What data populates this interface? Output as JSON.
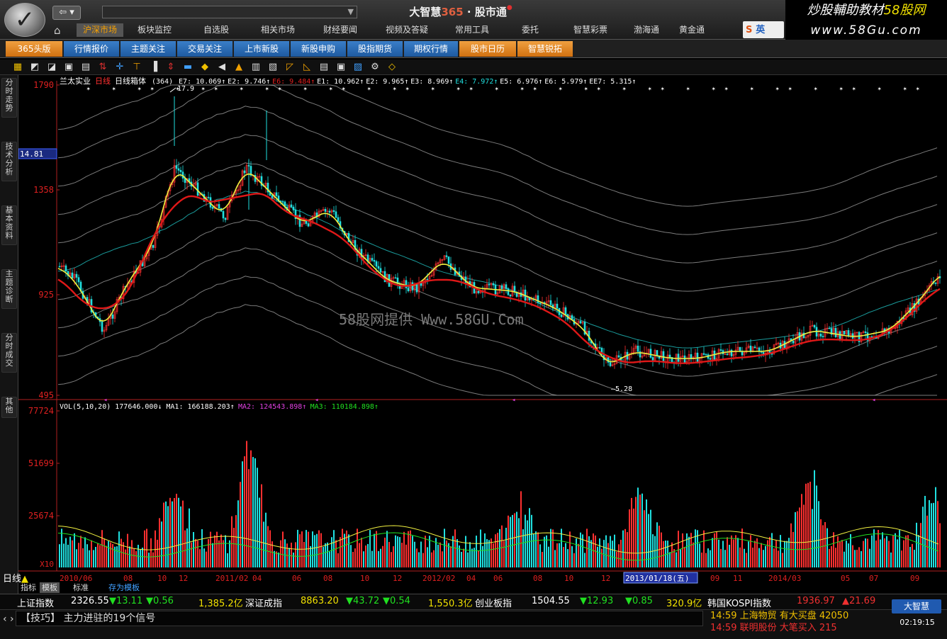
{
  "titlebar": {
    "logo_glyph": "✓",
    "back_label": "⇦ ▾",
    "home_icon": "⌂",
    "address_text": "",
    "address_dropdown": "▼",
    "app_name": "大智慧",
    "app_version": "365",
    "app_sep": "·",
    "app_sub": "股市通",
    "menu": [
      "沪深市场",
      "板块监控",
      "自选股",
      "相关市场",
      "财经要闻",
      "视频及答疑",
      "常用工具",
      "委托",
      "智慧彩票",
      "渤海通",
      "黄金通"
    ],
    "watermark_line1_a": "炒股輔助教材",
    "watermark_line1_b": "58股网",
    "watermark_line2": "www.58Gu.com",
    "ime_s": "S",
    "ime_label": "英"
  },
  "tabs": [
    "365头版",
    "行情报价",
    "主题关注",
    "交易关注",
    "上市新股",
    "新股申购",
    "股指期货",
    "期权行情",
    "股市日历",
    "智慧锐拓"
  ],
  "sidebar": [
    "分时走势",
    "技术分析",
    "基本资料",
    "主题诊断",
    "分时成交",
    "其他"
  ],
  "chart_data": {
    "type": "candlestick",
    "stock_name": "兰太实业",
    "period_label": "日线",
    "indicator_name": "日线箱体",
    "indicator_param": "(364)",
    "indicator_values": [
      {
        "name": "E7",
        "value": "10.069",
        "dir": "↑",
        "color": "#ffffff"
      },
      {
        "name": "E2",
        "value": "9.746",
        "dir": "↑",
        "color": "#ffffff"
      },
      {
        "name": "E6",
        "value": "9.484",
        "dir": "↑",
        "color": "#e02020"
      },
      {
        "name": "E1",
        "value": "10.962",
        "dir": "↑",
        "color": "#ffffff"
      },
      {
        "name": "E2",
        "value": "9.965",
        "dir": "↑",
        "color": "#ffffff"
      },
      {
        "name": "E3",
        "value": "8.969",
        "dir": "↑",
        "color": "#ffffff"
      },
      {
        "name": "E4",
        "value": "7.972",
        "dir": "↑",
        "color": "#20e0e0"
      },
      {
        "name": "E5",
        "value": "6.976",
        "dir": "↑",
        "color": "#ffffff"
      },
      {
        "name": "E6",
        "value": "5.979",
        "dir": "↑",
        "color": "#ffffff"
      },
      {
        "name": "EE7",
        "value": "5.315",
        "dir": "↑",
        "color": "#ffffff"
      }
    ],
    "price_ticks": [
      "1790",
      "1358",
      "925",
      "495"
    ],
    "current_price_label": "14.81",
    "max_marker": "17.9",
    "min_marker": "5.28",
    "vol_indicator": "VOL(5,10,20)",
    "vol_value": "177646.000",
    "vol_dir": "↓",
    "vol_mas": [
      {
        "name": "MA1",
        "value": "166188.203",
        "dir": "↑",
        "color": "#ffffff"
      },
      {
        "name": "MA2",
        "value": "124543.898",
        "dir": "↑",
        "color": "#e040e0"
      },
      {
        "name": "MA3",
        "value": "110184.898",
        "dir": "↑",
        "color": "#20e020"
      }
    ],
    "vol_ticks": [
      "77724",
      "51699",
      "25674"
    ],
    "vol_unit": "X10",
    "x_labels": [
      "2010/06",
      "08",
      "10",
      "12",
      "2011/02",
      "04",
      "06",
      "08",
      "10",
      "12",
      "2012/02",
      "04",
      "06",
      "08",
      "10",
      "12",
      "2013/01/18(五)",
      "09",
      "11",
      "2014/03",
      "05",
      "07",
      "09"
    ],
    "selected_date": "2013/01/18(五)",
    "watermark": "58股网提供 Www.58GU.Com",
    "colors": {
      "up": "#ff3030",
      "down": "#20e0e0",
      "ma_yellow": "#f0f040",
      "ma_red": "#e01818",
      "band": "#9a9a9a"
    }
  },
  "bottom": {
    "period": "日线",
    "period_icon": "▲",
    "tabs": [
      "指标",
      "模板",
      "标准",
      "存为模板"
    ]
  },
  "ticker": [
    {
      "name": "上证指数",
      "value": "2326.55",
      "change": "▼13.11",
      "pct": "▼0.56",
      "amount": "1,385.2亿"
    },
    {
      "name": "深证成指",
      "value": "8863.20",
      "change": "▼43.72",
      "pct": "▼0.54",
      "amount": "1,550.3亿"
    },
    {
      "name": "创业板指",
      "value": "1504.55",
      "change": "▼12.93",
      "pct": "▼0.85",
      "amount": "320.9亿"
    },
    {
      "name": "韩国KOSPI指数",
      "value": "1936.97",
      "change": "▲21.69"
    }
  ],
  "status": {
    "nav": "‹ ›",
    "star": "★",
    "tip": "【技巧】 主力进驻的19个信号",
    "news1": "14:59 上海物贸 有大买盘 42050",
    "news2": "14:59 联明股份 大笔买入 215",
    "brand": "大智慧",
    "time": "02:19:15"
  }
}
